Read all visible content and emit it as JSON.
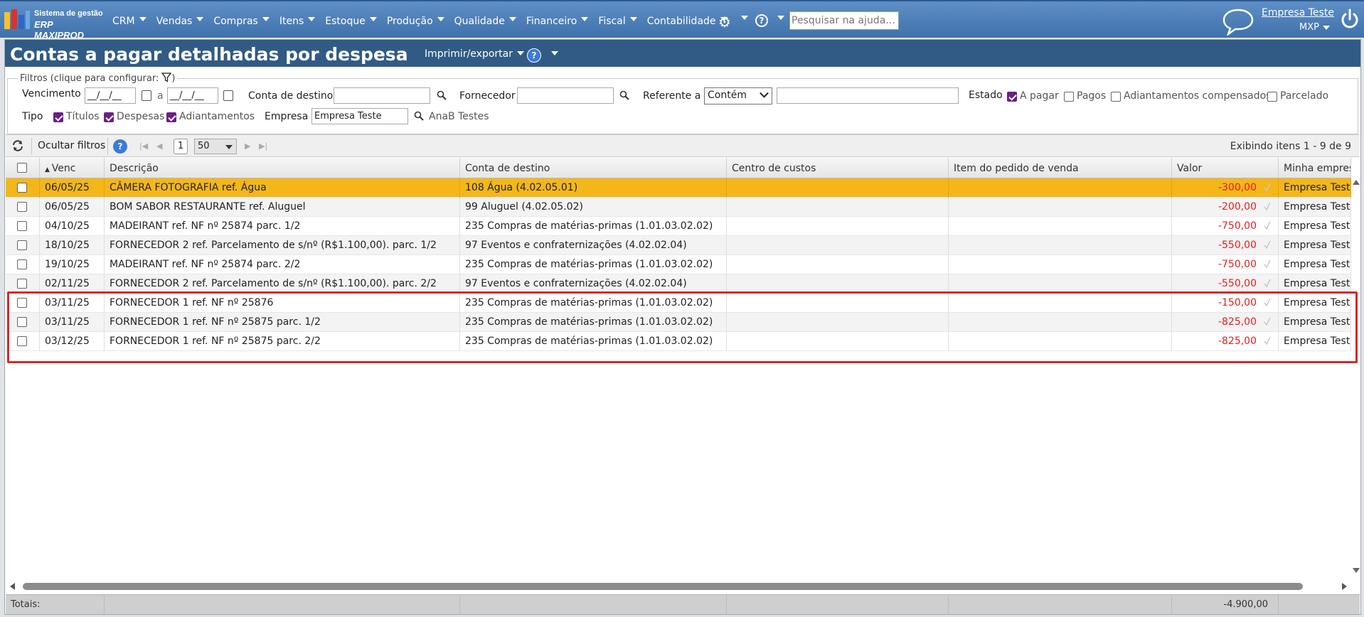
{
  "app": {
    "logo_line1": "Sistema de gestão",
    "logo_line2": "ERP MAXIPROD",
    "menu": [
      "CRM",
      "Vendas",
      "Compras",
      "Itens",
      "Estoque",
      "Produção",
      "Qualidade",
      "Financeiro",
      "Fiscal",
      "Contabilidade"
    ],
    "search_placeholder": "Pesquisar na ajuda...",
    "company": "Empresa Teste",
    "user": "MXP",
    "help_glyph": "?"
  },
  "page": {
    "title": "Contas a pagar detalhadas por despesa",
    "print_export": "Imprimir/exportar",
    "help_glyph": "?"
  },
  "filters": {
    "legend": "Filtros (clique para configurar:",
    "legend_close": ")",
    "vencimento_label": "Vencimento",
    "date_from": "__/__/__",
    "date_sep": "a",
    "date_to": "__/__/__",
    "conta_destino_label": "Conta de destino",
    "conta_destino_value": "",
    "fornecedor_label": "Fornecedor",
    "fornecedor_value": "",
    "referente_label": "Referente a",
    "referente_mode": "Contém",
    "referente_value": "",
    "estado_label": "Estado",
    "estado_options": [
      {
        "label": "A pagar",
        "checked": true
      },
      {
        "label": "Pagos",
        "checked": false
      },
      {
        "label": "Adiantamentos compensados",
        "checked": false
      },
      {
        "label": "Parcelado",
        "checked": false
      }
    ],
    "tipo_label": "Tipo",
    "tipo_options": [
      {
        "label": "Títulos",
        "checked": true
      },
      {
        "label": "Despesas",
        "checked": true
      },
      {
        "label": "Adiantamentos",
        "checked": true
      }
    ],
    "empresa_label": "Empresa",
    "empresa_value": "Empresa Teste",
    "empresa_hint": "AnaB Testes"
  },
  "grid": {
    "hide_filters": "Ocultar filtros",
    "help_glyph": "?",
    "page": "1",
    "page_size": "50",
    "info": "Exibindo itens 1 - 9 de 9",
    "columns": [
      "Venc",
      "Descrição",
      "Conta de destino",
      "Centro de custos",
      "Item do pedido de venda",
      "Valor",
      "Minha empres"
    ],
    "rows": [
      {
        "venc": "06/05/25",
        "desc": "CÂMERA FOTOGRAFIA ref. Água",
        "conta": "108 Água (4.02.05.01)",
        "centro": "",
        "item": "",
        "valor": "-300,00",
        "empresa": "Empresa Teste"
      },
      {
        "venc": "06/05/25",
        "desc": "BOM SABOR RESTAURANTE ref. Aluguel",
        "conta": "99 Aluguel (4.02.05.02)",
        "centro": "",
        "item": "",
        "valor": "-200,00",
        "empresa": "Empresa Teste"
      },
      {
        "venc": "04/10/25",
        "desc": "MADEIRANT ref. NF nº 25874 parc. 1/2",
        "conta": "235 Compras de matérias-primas (1.01.03.02.02)",
        "centro": "",
        "item": "",
        "valor": "-750,00",
        "empresa": "Empresa Teste"
      },
      {
        "venc": "18/10/25",
        "desc": "FORNECEDOR 2 ref. Parcelamento de s/nº (R$1.100,00). parc. 1/2",
        "conta": "97 Eventos e confraternizações (4.02.02.04)",
        "centro": "",
        "item": "",
        "valor": "-550,00",
        "empresa": "Empresa Teste"
      },
      {
        "venc": "19/10/25",
        "desc": "MADEIRANT ref. NF nº 25874 parc. 2/2",
        "conta": "235 Compras de matérias-primas (1.01.03.02.02)",
        "centro": "",
        "item": "",
        "valor": "-750,00",
        "empresa": "Empresa Teste"
      },
      {
        "venc": "02/11/25",
        "desc": "FORNECEDOR 2 ref. Parcelamento de s/nº (R$1.100,00). parc. 2/2",
        "conta": "97 Eventos e confraternizações (4.02.02.04)",
        "centro": "",
        "item": "",
        "valor": "-550,00",
        "empresa": "Empresa Teste"
      },
      {
        "venc": "03/11/25",
        "desc": "FORNECEDOR 1 ref. NF nº 25876",
        "conta": "235 Compras de matérias-primas (1.01.03.02.02)",
        "centro": "",
        "item": "",
        "valor": "-150,00",
        "empresa": "Empresa Teste"
      },
      {
        "venc": "03/11/25",
        "desc": "FORNECEDOR 1 ref. NF nº 25875 parc. 1/2",
        "conta": "235 Compras de matérias-primas (1.01.03.02.02)",
        "centro": "",
        "item": "",
        "valor": "-825,00",
        "empresa": "Empresa Teste"
      },
      {
        "venc": "03/12/25",
        "desc": "FORNECEDOR 1 ref. NF nº 25875 parc. 2/2",
        "conta": "235 Compras de matérias-primas (1.01.03.02.02)",
        "centro": "",
        "item": "",
        "valor": "-825,00",
        "empresa": "Empresa Teste"
      }
    ],
    "selected_row": 0,
    "totals_label": "Totais:",
    "totals_value": "-4.900,00"
  },
  "colors": {
    "nav": "#3f71ab",
    "title_bar": "#315b84",
    "selected_row": "#f4b71a",
    "negative_value": "#e02020",
    "highlight_box": "#e02424",
    "checkbox_checked": "#6b1f87"
  }
}
